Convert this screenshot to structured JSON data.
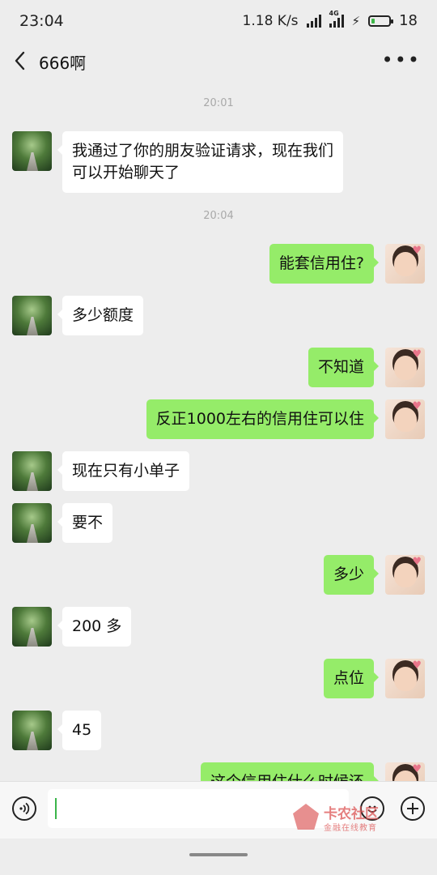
{
  "status_bar": {
    "time": "23:04",
    "speed": "1.18 K/s",
    "network": "4G",
    "battery": "18",
    "battery_level": 0.18,
    "battery_color": "#3fb84a"
  },
  "header": {
    "back_icon": "chevron-left-icon",
    "title": "666啊",
    "more_icon": "more-dots-icon"
  },
  "chat": {
    "timestamps": [
      "20:01",
      "20:04"
    ],
    "messages": [
      {
        "side": "left",
        "text": "我通过了你的朋友验证请求，现在我们\n可以开始聊天了"
      },
      {
        "side": "right",
        "text": "能套信用住?"
      },
      {
        "side": "left",
        "text": "多少额度"
      },
      {
        "side": "right",
        "text": "不知道"
      },
      {
        "side": "right",
        "text": "反正1000左右的信用住可以住"
      },
      {
        "side": "left",
        "text": "现在只有小单子"
      },
      {
        "side": "left",
        "text": "要不"
      },
      {
        "side": "right",
        "text": "多少"
      },
      {
        "side": "left",
        "text": "200 多"
      },
      {
        "side": "right",
        "text": "点位"
      },
      {
        "side": "left",
        "text": "45"
      },
      {
        "side": "right",
        "text": "这个信用住什么时候还"
      }
    ]
  },
  "input_bar": {
    "voice_icon": "voice-icon",
    "input_value": "",
    "emoji_icon": "emoji-icon",
    "plus_icon": "plus-icon"
  },
  "watermark": {
    "title": "卡农社区",
    "subtitle": "金融在线教育"
  },
  "colors": {
    "background": "#ededed",
    "bubble_sent": "#95ec69",
    "bubble_received": "#ffffff"
  }
}
